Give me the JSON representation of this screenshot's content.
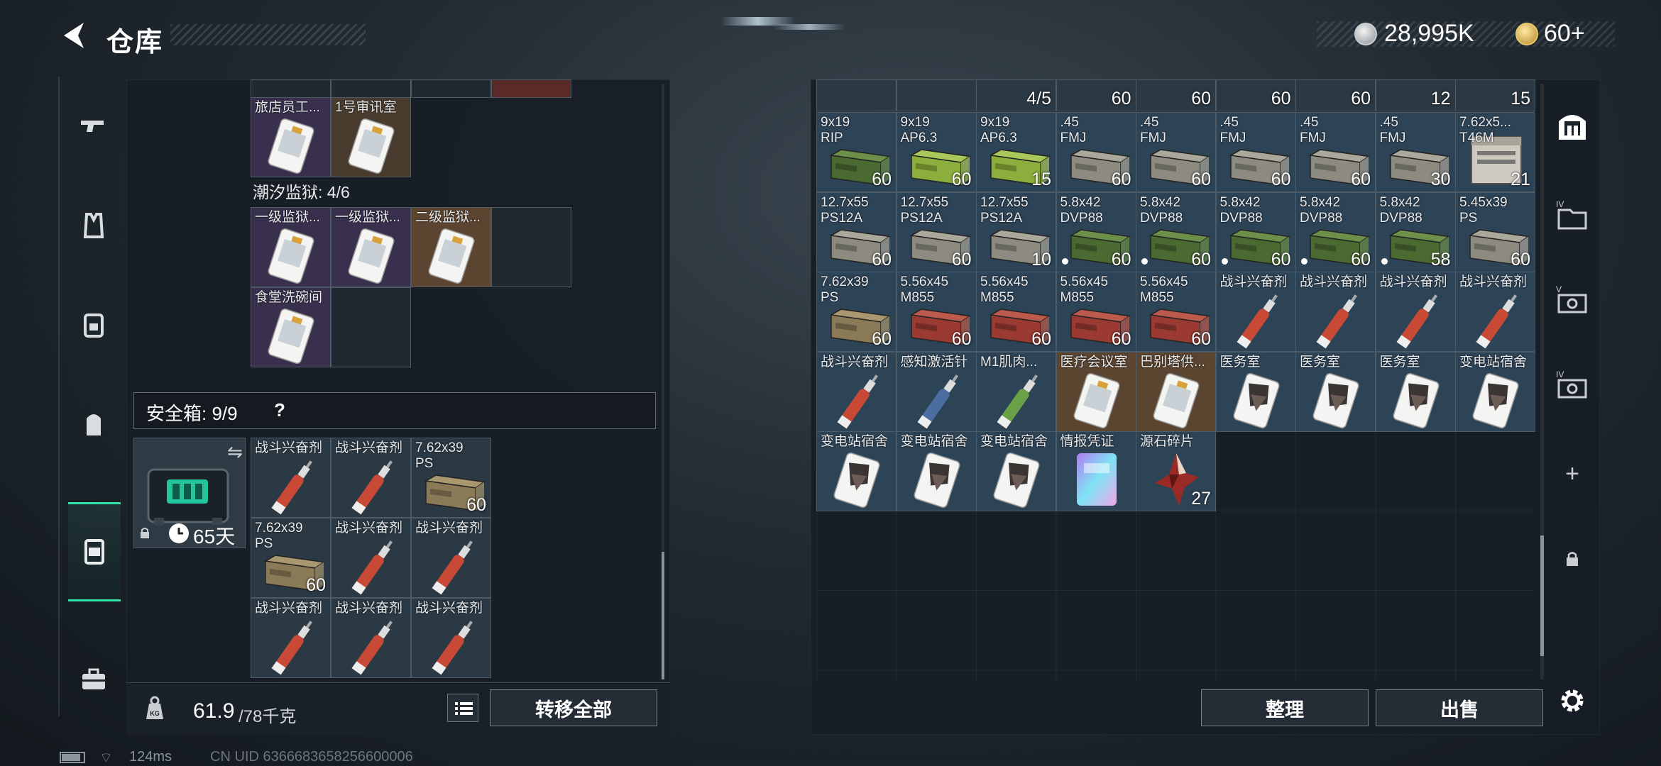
{
  "header": {
    "title": "仓库",
    "currency_coins": "28,995K",
    "currency_gold": "60+"
  },
  "left_nav": {
    "items": [
      "weapon-icon",
      "armor-vest-icon",
      "backpack-icon",
      "chest-rig-icon",
      "safe-case-icon",
      "briefcase-icon"
    ],
    "active_index": 4
  },
  "left_panel": {
    "top_row_partial": [
      {
        "label": "旅店员工...",
        "style": "purple",
        "item": "keycard"
      },
      {
        "label": "1号审讯室",
        "style": "brown",
        "item": "keycard"
      }
    ],
    "tidal_prison": {
      "title": "潮汐监狱: 4/6",
      "cells": [
        {
          "label": "一级监狱...",
          "style": "purple",
          "item": "keycard"
        },
        {
          "label": "一级监狱...",
          "style": "purple",
          "item": "keycard"
        },
        {
          "label": "二级监狱...",
          "style": "gold",
          "item": "keycard"
        },
        {
          "label": "",
          "style": "empty"
        },
        {
          "label": "食堂洗碗间",
          "style": "purple",
          "item": "keycard"
        },
        {
          "label": "",
          "style": "empty"
        }
      ]
    },
    "safe_box": {
      "label": "安全箱:",
      "count": "9/9",
      "help": "?",
      "days": "65天",
      "items": [
        {
          "label": "战斗兴奋剂",
          "item": "stim-red"
        },
        {
          "label": "战斗兴奋剂",
          "item": "stim-red"
        },
        {
          "label": "7.62x39\nPS",
          "item": "ammo-tan",
          "count": "60"
        },
        {
          "label": "7.62x39\nPS",
          "item": "ammo-tan",
          "count": "60"
        },
        {
          "label": "战斗兴奋剂",
          "item": "stim-red"
        },
        {
          "label": "战斗兴奋剂",
          "item": "stim-red"
        },
        {
          "label": "战斗兴奋剂",
          "item": "stim-red"
        },
        {
          "label": "战斗兴奋剂",
          "item": "stim-red"
        },
        {
          "label": "战斗兴奋剂",
          "item": "stim-red"
        }
      ]
    },
    "weight": {
      "current": "61.9",
      "max_unit": "/78千克"
    },
    "transfer_all": "转移全部"
  },
  "right_panel": {
    "partial_top_counts": [
      "",
      "",
      "4/5",
      "60",
      "60",
      "60",
      "60",
      "12",
      "15"
    ],
    "rows": [
      [
        {
          "label": "9x19\nRIP",
          "item": "ammo-green",
          "count": "60"
        },
        {
          "label": "9x19\nAP6.3",
          "item": "ammo-lime",
          "count": "60"
        },
        {
          "label": "9x19\nAP6.3",
          "item": "ammo-lime",
          "count": "15"
        },
        {
          "label": ".45\nFMJ",
          "item": "ammo-grey",
          "count": "60"
        },
        {
          "label": ".45\nFMJ",
          "item": "ammo-grey",
          "count": "60"
        },
        {
          "label": ".45\nFMJ",
          "item": "ammo-grey",
          "count": "60"
        },
        {
          "label": ".45\nFMJ",
          "item": "ammo-grey",
          "count": "60"
        },
        {
          "label": ".45\nFMJ",
          "item": "ammo-grey",
          "count": "30"
        },
        {
          "label": "7.62x5...\nT46M",
          "item": "ammo-crate",
          "count": "21"
        }
      ],
      [
        {
          "label": "12.7x55\nPS12A",
          "item": "ammo-grey",
          "count": "60"
        },
        {
          "label": "12.7x55\nPS12A",
          "item": "ammo-grey",
          "count": "60"
        },
        {
          "label": "12.7x55\nPS12A",
          "item": "ammo-grey",
          "count": "10"
        },
        {
          "label": "5.8x42\nDVP88",
          "item": "ammo-green",
          "count": "60",
          "dot": true
        },
        {
          "label": "5.8x42\nDVP88",
          "item": "ammo-green",
          "count": "60",
          "dot": true
        },
        {
          "label": "5.8x42\nDVP88",
          "item": "ammo-green",
          "count": "60",
          "dot": true
        },
        {
          "label": "5.8x42\nDVP88",
          "item": "ammo-green",
          "count": "60",
          "dot": true
        },
        {
          "label": "5.8x42\nDVP88",
          "item": "ammo-green",
          "count": "58",
          "dot": true
        },
        {
          "label": "5.45x39\nPS",
          "item": "ammo-grey",
          "count": "60"
        }
      ],
      [
        {
          "label": "7.62x39\nPS",
          "item": "ammo-tan",
          "count": "60"
        },
        {
          "label": "5.56x45\nM855",
          "item": "ammo-red",
          "count": "60"
        },
        {
          "label": "5.56x45\nM855",
          "item": "ammo-red",
          "count": "60"
        },
        {
          "label": "5.56x45\nM855",
          "item": "ammo-red",
          "count": "60"
        },
        {
          "label": "5.56x45\nM855",
          "item": "ammo-red",
          "count": "60"
        },
        {
          "label": "战斗兴奋剂",
          "item": "stim-red"
        },
        {
          "label": "战斗兴奋剂",
          "item": "stim-red"
        },
        {
          "label": "战斗兴奋剂",
          "item": "stim-red"
        },
        {
          "label": "战斗兴奋剂",
          "item": "stim-red"
        }
      ],
      [
        {
          "label": "战斗兴奋剂",
          "item": "stim-red"
        },
        {
          "label": "感知激活针",
          "item": "stim-blue"
        },
        {
          "label": "M1肌肉...",
          "item": "stim-green"
        },
        {
          "label": "医疗会议室",
          "item": "keycard",
          "style": "gold"
        },
        {
          "label": "巴别塔供...",
          "item": "keycard",
          "style": "gold"
        },
        {
          "label": "医务室",
          "item": "keycard-dark"
        },
        {
          "label": "医务室",
          "item": "keycard-dark"
        },
        {
          "label": "医务室",
          "item": "keycard-dark"
        },
        {
          "label": "变电站宿舍",
          "item": "keycard-dark"
        }
      ],
      [
        {
          "label": "变电站宿舍",
          "item": "keycard-dark"
        },
        {
          "label": "变电站宿舍",
          "item": "keycard-dark"
        },
        {
          "label": "变电站宿舍",
          "item": "keycard-dark"
        },
        {
          "label": "情报凭证",
          "item": "holo-card"
        },
        {
          "label": "源石碎片",
          "item": "crystal",
          "count": "27"
        }
      ]
    ],
    "sort_button": "整理",
    "sell_button": "出售"
  },
  "right_nav": {
    "items": [
      "storage-home-icon",
      "storage-tab-4-icon",
      "storage-tab-5-icon",
      "storage-tab-6-icon"
    ],
    "tab_numbers": [
      "IV",
      "V",
      "IV"
    ],
    "add": "+"
  },
  "status_bar": {
    "ping": "124ms",
    "uid": "CN UID 6366683658256600006"
  },
  "colors": {
    "accent": "#2fe3a7",
    "panel": "#1a2128",
    "cell": "#2b3944",
    "cell_purple": "#38304d",
    "cell_gold": "#5c4530"
  }
}
